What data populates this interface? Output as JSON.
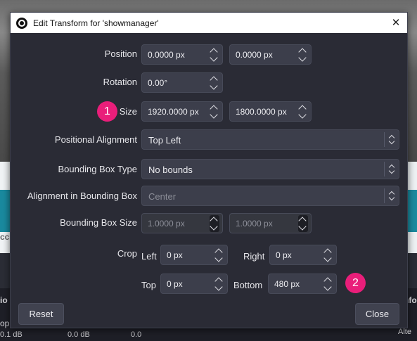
{
  "window": {
    "title": "Edit Transform for 'showmanager'"
  },
  "position": {
    "label": "Position",
    "x": "0.0000 px",
    "y": "0.0000 px"
  },
  "rotation": {
    "label": "Rotation",
    "value": "0.00°"
  },
  "size": {
    "label": "Size",
    "width": "1920.0000 px",
    "height": "1800.0000 px"
  },
  "positional_alignment": {
    "label": "Positional Alignment",
    "value": "Top Left"
  },
  "bounding_box_type": {
    "label": "Bounding Box Type",
    "value": "No bounds"
  },
  "alignment_in_bounding_box": {
    "label": "Alignment in Bounding Box",
    "value": "Center"
  },
  "bounding_box_size": {
    "label": "Bounding Box Size",
    "width": "1.0000 px",
    "height": "1.0000 px"
  },
  "crop": {
    "label": "Crop",
    "left_label": "Left",
    "left": "0 px",
    "right_label": "Right",
    "right": "0 px",
    "top_label": "Top",
    "top": "0 px",
    "bottom_label": "Bottom",
    "bottom": "480 px"
  },
  "buttons": {
    "reset": "Reset",
    "close": "Close"
  },
  "annotations": {
    "badge1": "1",
    "badge2": "2",
    "badge_color": "#e91e7a"
  },
  "background": {
    "left_edge_texts": [
      "b",
      "cc",
      "io",
      "op"
    ],
    "right_edge_text": "nfo",
    "right_bottom_text": "Alte",
    "meters": [
      "0.1 dB",
      "0.0 dB",
      "0.0"
    ]
  }
}
